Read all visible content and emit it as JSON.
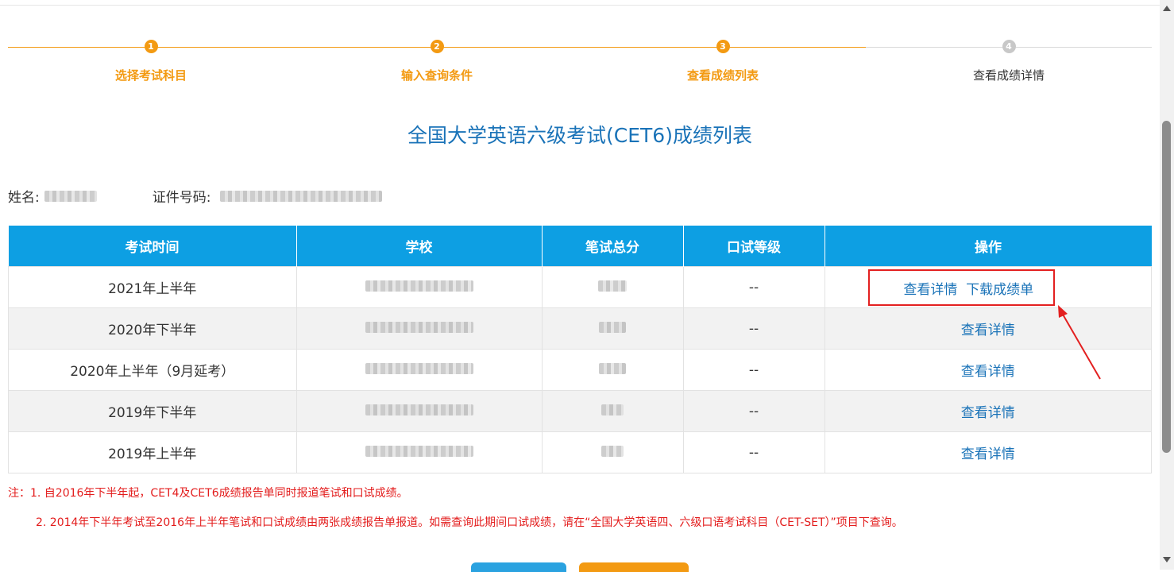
{
  "steps": [
    {
      "num": "1",
      "label": "选择考试科目",
      "state": "done"
    },
    {
      "num": "2",
      "label": "输入查询条件",
      "state": "done"
    },
    {
      "num": "3",
      "label": "查看成绩列表",
      "state": "done"
    },
    {
      "num": "4",
      "label": "查看成绩详情",
      "state": "todo"
    }
  ],
  "page_title": "全国大学英语六级考试(CET6)成绩列表",
  "info": {
    "name_label": "姓名:",
    "id_label": "证件号码:"
  },
  "table": {
    "headers": [
      "考试时间",
      "学校",
      "笔试总分",
      "口试等级",
      "操作"
    ],
    "rows": [
      {
        "time": "2021年上半年",
        "oral": "--",
        "detail": "查看详情",
        "download": "下载成绩单"
      },
      {
        "time": "2020年下半年",
        "oral": "--",
        "detail": "查看详情"
      },
      {
        "time": "2020年上半年（9月延考）",
        "oral": "--",
        "detail": "查看详情"
      },
      {
        "time": "2019年下半年",
        "oral": "--",
        "detail": "查看详情"
      },
      {
        "time": "2019年上半年",
        "oral": "--",
        "detail": "查看详情"
      }
    ]
  },
  "notes": {
    "line1": "注：1. 自2016年下半年起，CET4及CET6成绩报告单同时报道笔试和口试成绩。",
    "line2": "2. 2014年下半年考试至2016年上半年笔试和口试成绩由两张成绩报告单报道。如需查询此期间口试成绩，请在“全国大学英语四、六级口语考试科目（CET-SET）”项目下查询。"
  },
  "colors": {
    "accent_orange": "#f39a12",
    "header_blue": "#0d9fe3",
    "link_blue": "#1a73b8",
    "note_red": "#e31d1d"
  }
}
